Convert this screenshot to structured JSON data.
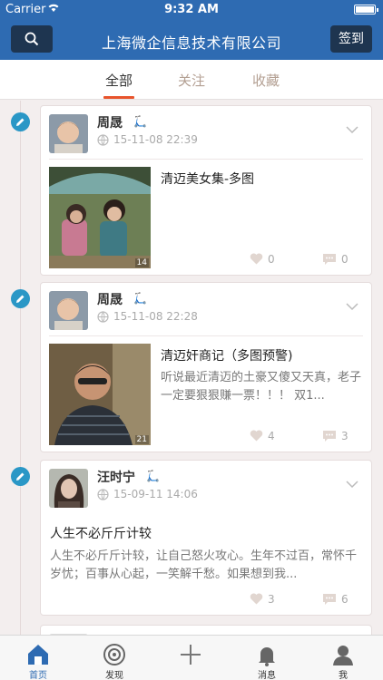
{
  "status_bar": {
    "carrier": "Carrier",
    "time": "9:32 AM"
  },
  "nav": {
    "title": "上海微企信息技术有限公司",
    "signin_label": "签到",
    "search_icon": "search-icon"
  },
  "tabs": [
    {
      "label": "全部",
      "active": true
    },
    {
      "label": "关注",
      "active": false
    },
    {
      "label": "收藏",
      "active": false
    }
  ],
  "posts": [
    {
      "author": "周晟",
      "date": "15-11-08 22:39",
      "title": "清迈美女集-多图",
      "excerpt": "",
      "image_count": "14",
      "likes": "0",
      "comments": "0"
    },
    {
      "author": "周晟",
      "date": "15-11-08 22:28",
      "title": "清迈奸商记（多图预警)",
      "excerpt": "听说最近清迈的土豪又傻又天真，老子一定要狠狠赚一票！！！ 双1...",
      "image_count": "21",
      "likes": "4",
      "comments": "3"
    },
    {
      "author": "汪时宁",
      "date": "15-09-11 14:06",
      "title": "人生不必斤斤计较",
      "excerpt": "人生不必斤斤计较，让自己怒火攻心。生年不过百，常怀千岁忧；百事从心起，一笑解千愁。如果想到我...",
      "image_count": "",
      "likes": "3",
      "comments": "6"
    }
  ],
  "tab_bar": [
    {
      "label": "首页",
      "icon": "home-icon",
      "active": true
    },
    {
      "label": "发现",
      "icon": "compass-icon",
      "active": false
    },
    {
      "label": "",
      "icon": "plus-icon",
      "active": false
    },
    {
      "label": "消息",
      "icon": "bell-icon",
      "active": false
    },
    {
      "label": "我",
      "icon": "person-icon",
      "active": false
    }
  ],
  "colors": {
    "brand_blue": "#2e6bb2",
    "nav_button": "#1e3550",
    "accent_orange": "#e8542c",
    "pencil_blue": "#2a97c6"
  }
}
